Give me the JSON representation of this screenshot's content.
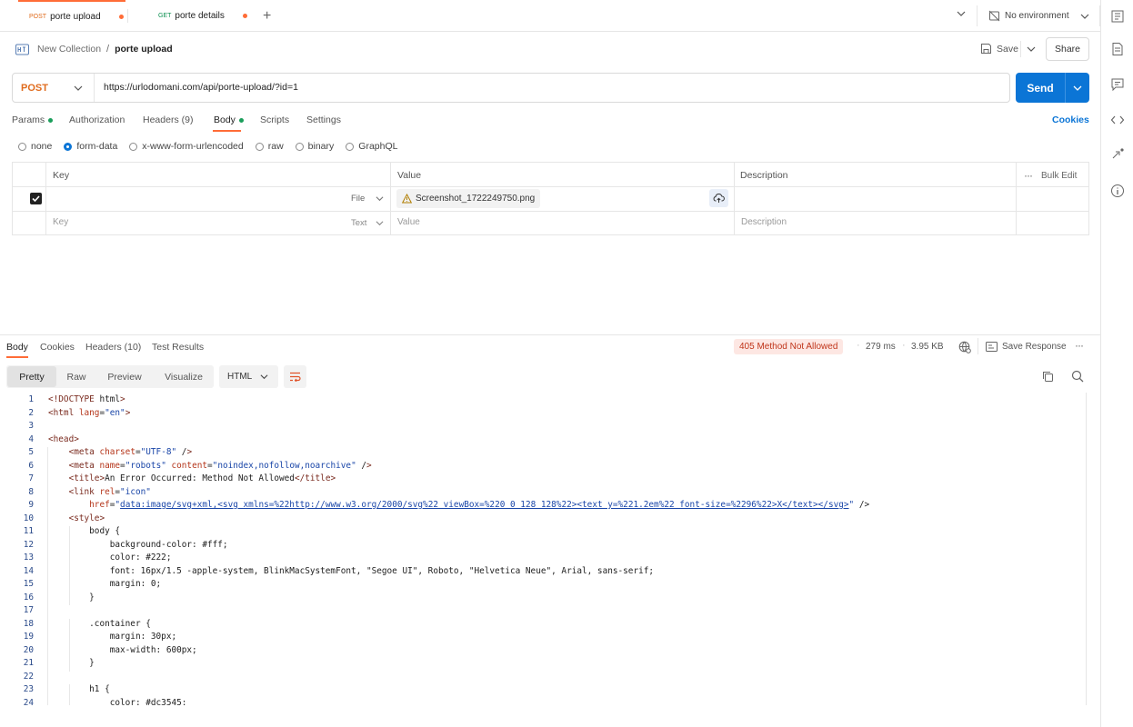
{
  "tabs": [
    {
      "method": "POST",
      "name": "porte upload",
      "active": true
    },
    {
      "method": "GET",
      "name": "porte details",
      "active": false
    }
  ],
  "environment": "No environment",
  "breadcrumb": {
    "collection": "New Collection",
    "separator": "/",
    "request": "porte upload"
  },
  "actions": {
    "save": "Save",
    "share": "Share"
  },
  "request": {
    "method": "POST",
    "url": "https://urlodomani.com/api/porte-upload/?id=1",
    "send": "Send"
  },
  "request_tabs": [
    "Params",
    "Authorization",
    "Headers (9)",
    "Body",
    "Scripts",
    "Settings"
  ],
  "cookies": "Cookies",
  "body_modes": [
    "none",
    "form-data",
    "x-www-form-urlencoded",
    "raw",
    "binary",
    "GraphQL"
  ],
  "body_mode_selected": "form-data",
  "table": {
    "headers": [
      "Key",
      "Value",
      "Description"
    ],
    "bulk_edit": "Bulk Edit",
    "rows": [
      {
        "checked": true,
        "key": "",
        "type": "File",
        "value": "Screenshot_1722249750.png",
        "description": ""
      },
      {
        "checked": false,
        "key_placeholder": "Key",
        "type": "Text",
        "value_placeholder": "Value",
        "description_placeholder": "Description"
      }
    ]
  },
  "response": {
    "tabs": [
      "Body",
      "Cookies",
      "Headers (10)",
      "Test Results"
    ],
    "status": "405 Method Not Allowed",
    "time": "279 ms",
    "size": "3.95 KB",
    "save_response": "Save Response",
    "view_modes": [
      "Pretty",
      "Raw",
      "Preview",
      "Visualize"
    ],
    "format": "HTML",
    "colors": {
      "status_bg": "#fde7e3",
      "status_text": "#c0361b",
      "accent": "#0b75d6",
      "method": "#e06c1e"
    }
  },
  "code_lines": [
    {
      "n": "1",
      "t": "<!DOCTYPE html>"
    },
    {
      "n": "2",
      "t": "<html lang=\"en\">"
    },
    {
      "n": "3",
      "t": ""
    },
    {
      "n": "4",
      "t": "<head>"
    },
    {
      "n": "5",
      "t": "    <meta charset=\"UTF-8\" />"
    },
    {
      "n": "6",
      "t": "    <meta name=\"robots\" content=\"noindex,nofollow,noarchive\" />"
    },
    {
      "n": "7",
      "t": "    <title>An Error Occurred: Method Not Allowed</title>"
    },
    {
      "n": "8",
      "t": "    <link rel=\"icon\""
    },
    {
      "n": "9",
      "t": "        href=\"data:image/svg+xml,<svg xmlns=%22http://www.w3.org/2000/svg%22 viewBox=%220 0 128 128%22><text y=%221.2em%22 font-size=%2296%22>X</text></svg>\" />"
    },
    {
      "n": "10",
      "t": "    <style>"
    },
    {
      "n": "11",
      "t": "        body {"
    },
    {
      "n": "12",
      "t": "            background-color: #fff;"
    },
    {
      "n": "13",
      "t": "            color: #222;"
    },
    {
      "n": "14",
      "t": "            font: 16px/1.5 -apple-system, BlinkMacSystemFont, \"Segoe UI\", Roboto, \"Helvetica Neue\", Arial, sans-serif;"
    },
    {
      "n": "15",
      "t": "            margin: 0;"
    },
    {
      "n": "16",
      "t": "        }"
    },
    {
      "n": "17",
      "t": ""
    },
    {
      "n": "18",
      "t": "        .container {"
    },
    {
      "n": "19",
      "t": "            margin: 30px;"
    },
    {
      "n": "20",
      "t": "            max-width: 600px;"
    },
    {
      "n": "21",
      "t": "        }"
    },
    {
      "n": "22",
      "t": ""
    },
    {
      "n": "23",
      "t": "        h1 {"
    },
    {
      "n": "24",
      "t": "            color: #dc3545;"
    }
  ]
}
